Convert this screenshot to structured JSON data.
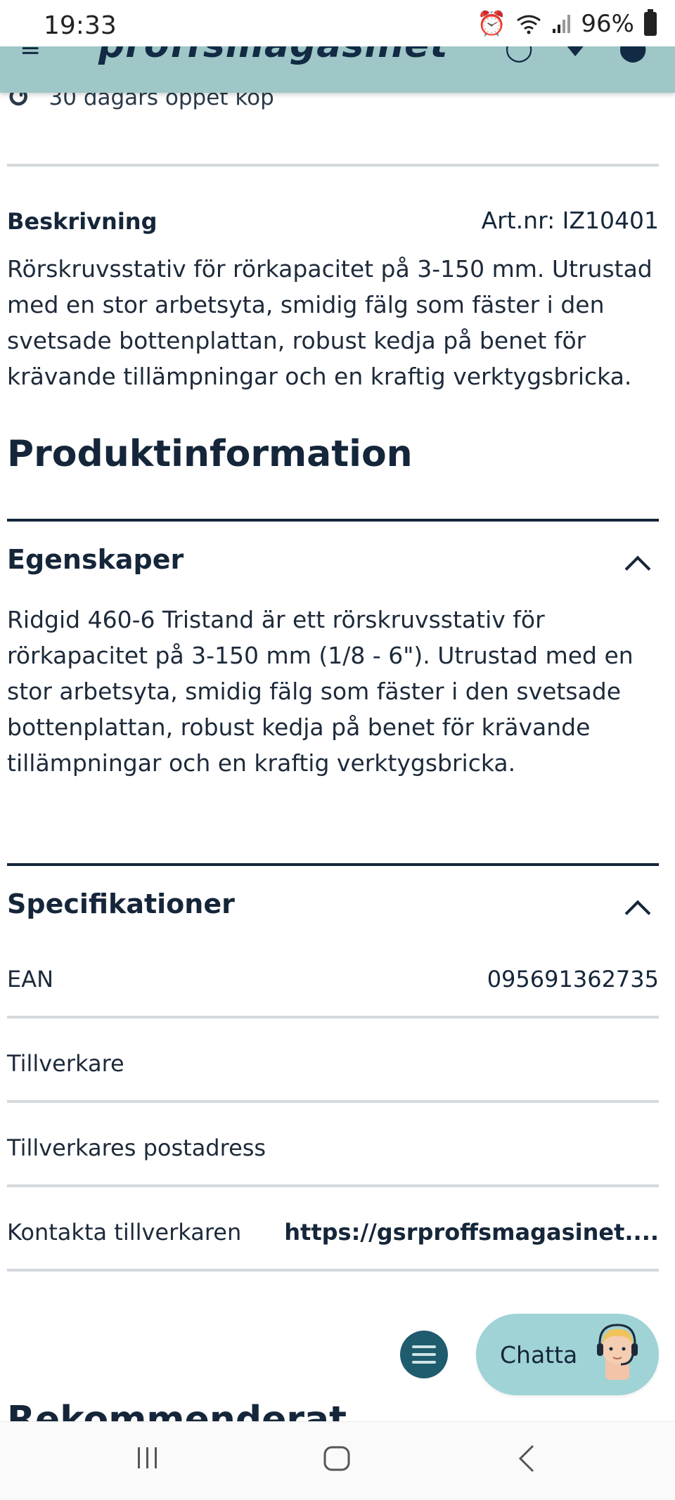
{
  "status_bar": {
    "time": "19:33",
    "battery": "96%",
    "icons": [
      "alarm-icon",
      "wifi-icon",
      "signal-icon",
      "battery-icon"
    ]
  },
  "header": {
    "logo": "proffsmagasinet",
    "icons": [
      "menu-icon",
      "search-icon",
      "user-icon",
      "favorite-icon",
      "cart-icon"
    ]
  },
  "return_policy": {
    "text": "30 dagars öppet köp",
    "icon": "return-icon"
  },
  "description": {
    "heading": "Beskrivning",
    "art_nr": "Art.nr: IZ10401",
    "text": "Rörskruvsstativ för rörkapacitet på 3-150 mm. Utrustad med en stor arbetsyta, smidig fälg som fäster i den svetsade bottenplattan, robust kedja på benet för krävande tillämpningar och en kraftig verktygsbricka."
  },
  "product_info": {
    "heading": "Produktinformation",
    "properties": {
      "title": "Egenskaper",
      "text": "Ridgid 460-6 Tristand är ett rörskruvsstativ för rörkapacitet på 3-150 mm (1/8 - 6\"). Utrustad med en stor arbetsyta, smidig fälg som fäster i den svetsade bottenplattan, robust kedja på benet för krävande tillämpningar och en kraftig verktygsbricka."
    },
    "specifications": {
      "title": "Specifikationer",
      "rows": [
        {
          "label": "EAN",
          "value": "095691362735"
        },
        {
          "label": "Tillverkare",
          "value": ""
        },
        {
          "label": "Tillverkares postadress",
          "value": ""
        },
        {
          "label": "Kontakta tillverkaren",
          "value": "https://gsrproffsmagasinet...."
        }
      ]
    }
  },
  "chat": {
    "label": "Chatta",
    "avatar_icon": "support-agent-icon"
  },
  "next_section": {
    "heading": "Rekommenderat"
  },
  "nav": {
    "icons": [
      "recent-apps-icon",
      "home-icon",
      "back-icon"
    ]
  },
  "colors": {
    "header_bg": "#9fc7c7",
    "text_dark": "#15263a",
    "chat_bg": "#9fd3d6",
    "menu_fab": "#1f5c6e"
  }
}
